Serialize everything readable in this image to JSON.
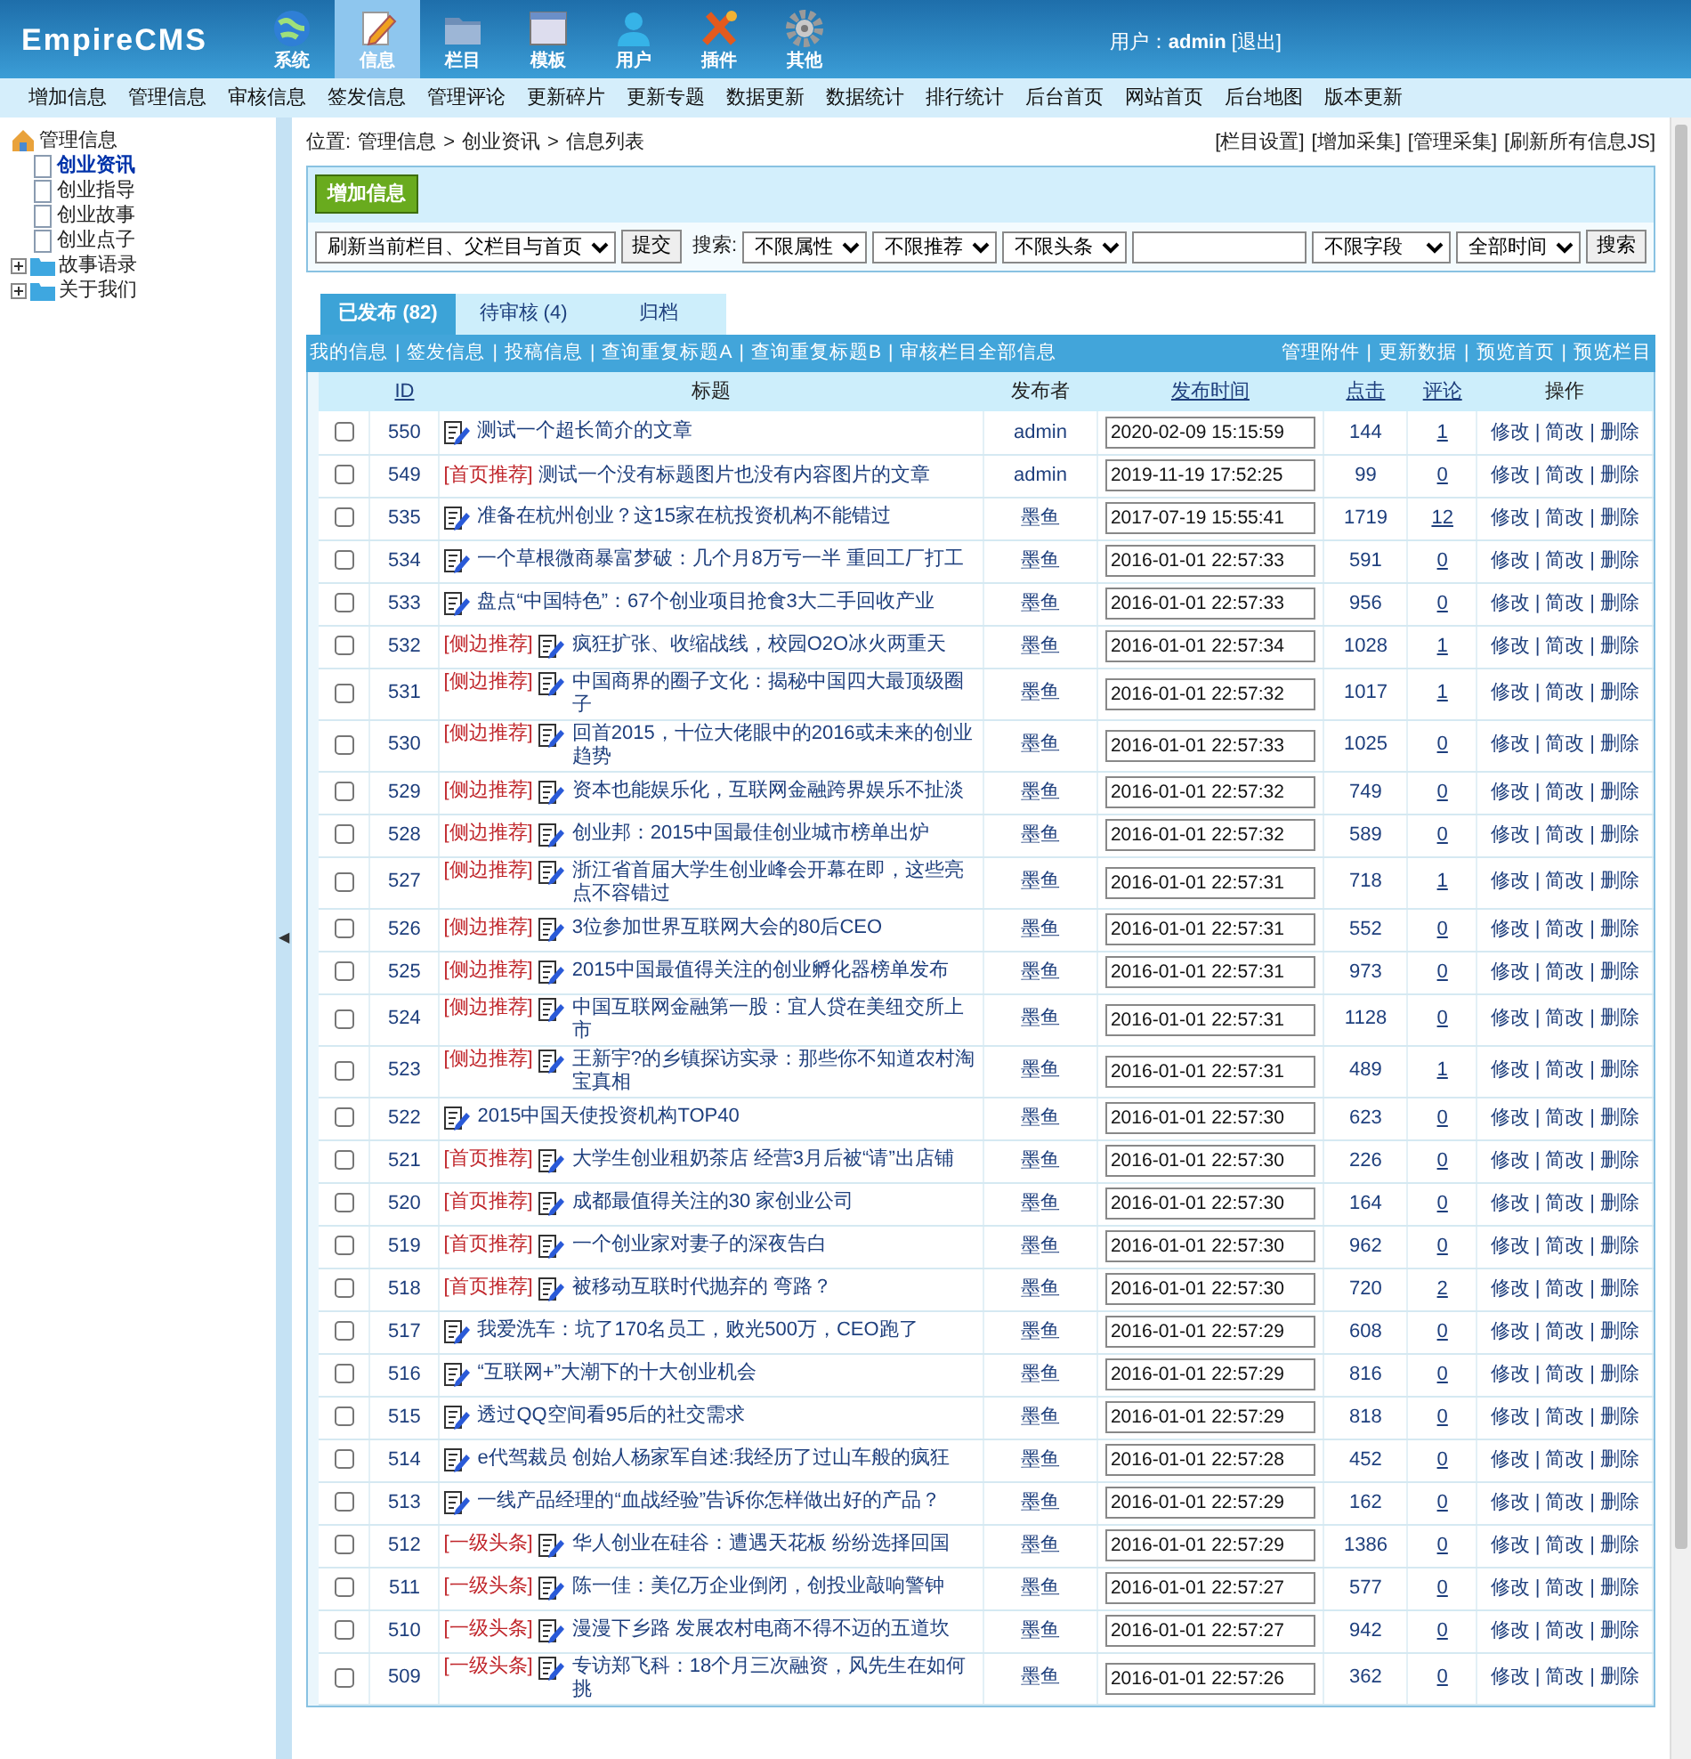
{
  "header": {
    "logo": "EmpireCMS",
    "nav": [
      {
        "label": "系统",
        "selected": false
      },
      {
        "label": "信息",
        "selected": true
      },
      {
        "label": "栏目",
        "selected": false
      },
      {
        "label": "模板",
        "selected": false
      },
      {
        "label": "用户",
        "selected": false
      },
      {
        "label": "插件",
        "selected": false
      },
      {
        "label": "其他",
        "selected": false
      }
    ],
    "user_label": "用户：",
    "user": "admin",
    "logout": "[退出]"
  },
  "menu": [
    "增加信息",
    "管理信息",
    "审核信息",
    "签发信息",
    "管理评论",
    "更新碎片",
    "更新专题",
    "数据更新",
    "数据统计",
    "排行统计",
    "后台首页",
    "网站首页",
    "后台地图",
    "版本更新"
  ],
  "sidebar": {
    "tree": [
      {
        "label": "管理信息",
        "expanded": true,
        "children": [
          {
            "label": "创业资讯",
            "selected": true
          },
          {
            "label": "创业指导",
            "selected": false
          },
          {
            "label": "创业故事",
            "selected": false
          },
          {
            "label": "创业点子",
            "selected": false
          }
        ]
      },
      {
        "label": "故事语录",
        "expanded": false
      },
      {
        "label": "关于我们",
        "expanded": false
      }
    ]
  },
  "breadcrumb": {
    "label": "位置:",
    "items": [
      "管理信息",
      "创业资讯",
      "信息列表"
    ],
    "sep": ">"
  },
  "top_links": [
    "[栏目设置]",
    "[增加采集]",
    "[管理采集]",
    "[刷新所有信息JS]"
  ],
  "toolbar": {
    "add_button": "增加信息",
    "refresh_select": "刷新当前栏目、父栏目与首页",
    "submit_button": "提交",
    "search_label": "搜索:",
    "filters": [
      "不限属性",
      "不限推荐",
      "不限头条"
    ],
    "field_select": "不限字段",
    "time_select": "全部时间",
    "search_button": "搜索"
  },
  "tabs": [
    {
      "label": "已发布 (82)",
      "selected": true
    },
    {
      "label": "待审核 (4)",
      "selected": false
    },
    {
      "label": "归档",
      "selected": false
    }
  ],
  "splitter": {
    "arrow": "◀"
  },
  "link_separator": "|",
  "action_separator": "|",
  "links_left": [
    "我的信息",
    "签发信息",
    "投稿信息",
    "查询重复标题A",
    "查询重复标题B",
    "审核栏目全部信息"
  ],
  "links_right": [
    "管理附件",
    "更新数据",
    "预览首页",
    "预览栏目"
  ],
  "table": {
    "columns": [
      "",
      "ID",
      "标题",
      "发布者",
      "发布时间",
      "点击",
      "评论",
      "操作"
    ],
    "rows": [
      {
        "checked": false,
        "id": "550",
        "tag": "",
        "icon": true,
        "title": "测试一个超长简介的文章",
        "author": "admin",
        "time": "2020-02-09 15:15:59",
        "clicks": "144",
        "comments": "1",
        "actions": [
          "修改",
          "简改",
          "删除"
        ]
      },
      {
        "checked": false,
        "id": "549",
        "tag": "[首页推荐]",
        "icon": false,
        "title": "测试一个没有标题图片也没有内容图片的文章",
        "author": "admin",
        "time": "2019-11-19 17:52:25",
        "clicks": "99",
        "comments": "0",
        "actions": [
          "修改",
          "简改",
          "删除"
        ]
      },
      {
        "checked": false,
        "id": "535",
        "tag": "",
        "icon": true,
        "title": "准备在杭州创业？这15家在杭投资机构不能错过",
        "author": "墨鱼",
        "time": "2017-07-19 15:55:41",
        "clicks": "1719",
        "comments": "12",
        "actions": [
          "修改",
          "简改",
          "删除"
        ]
      },
      {
        "checked": false,
        "id": "534",
        "tag": "",
        "icon": true,
        "title": "一个草根微商暴富梦破：几个月8万亏一半 重回工厂打工",
        "author": "墨鱼",
        "time": "2016-01-01 22:57:33",
        "clicks": "591",
        "comments": "0",
        "actions": [
          "修改",
          "简改",
          "删除"
        ]
      },
      {
        "checked": false,
        "id": "533",
        "tag": "",
        "icon": true,
        "title": "盘点“中国特色”：67个创业项目抢食3大二手回收产业",
        "author": "墨鱼",
        "time": "2016-01-01 22:57:33",
        "clicks": "956",
        "comments": "0",
        "actions": [
          "修改",
          "简改",
          "删除"
        ]
      },
      {
        "checked": false,
        "id": "532",
        "tag": "[侧边推荐]",
        "icon": true,
        "title": "疯狂扩张、收缩战线，校园O2O冰火两重天",
        "author": "墨鱼",
        "time": "2016-01-01 22:57:34",
        "clicks": "1028",
        "comments": "1",
        "actions": [
          "修改",
          "简改",
          "删除"
        ]
      },
      {
        "checked": false,
        "id": "531",
        "tag": "[侧边推荐]",
        "icon": true,
        "title": "中国商界的圈子文化：揭秘中国四大最顶级圈子",
        "author": "墨鱼",
        "time": "2016-01-01 22:57:32",
        "clicks": "1017",
        "comments": "1",
        "actions": [
          "修改",
          "简改",
          "删除"
        ]
      },
      {
        "checked": false,
        "id": "530",
        "tag": "[侧边推荐]",
        "icon": true,
        "title": "回首2015，十位大佬眼中的2016或未来的创业趋势",
        "author": "墨鱼",
        "time": "2016-01-01 22:57:33",
        "clicks": "1025",
        "comments": "0",
        "actions": [
          "修改",
          "简改",
          "删除"
        ]
      },
      {
        "checked": false,
        "id": "529",
        "tag": "[侧边推荐]",
        "icon": true,
        "title": "资本也能娱乐化，互联网金融跨界娱乐不扯淡",
        "author": "墨鱼",
        "time": "2016-01-01 22:57:32",
        "clicks": "749",
        "comments": "0",
        "actions": [
          "修改",
          "简改",
          "删除"
        ]
      },
      {
        "checked": false,
        "id": "528",
        "tag": "[侧边推荐]",
        "icon": true,
        "title": "创业邦：2015中国最佳创业城市榜单出炉",
        "author": "墨鱼",
        "time": "2016-01-01 22:57:32",
        "clicks": "589",
        "comments": "0",
        "actions": [
          "修改",
          "简改",
          "删除"
        ]
      },
      {
        "checked": false,
        "id": "527",
        "tag": "[侧边推荐]",
        "icon": true,
        "title": "浙江省首届大学生创业峰会开幕在即，这些亮点不容错过",
        "author": "墨鱼",
        "time": "2016-01-01 22:57:31",
        "clicks": "718",
        "comments": "1",
        "actions": [
          "修改",
          "简改",
          "删除"
        ]
      },
      {
        "checked": false,
        "id": "526",
        "tag": "[侧边推荐]",
        "icon": true,
        "title": "3位参加世界互联网大会的80后CEO",
        "author": "墨鱼",
        "time": "2016-01-01 22:57:31",
        "clicks": "552",
        "comments": "0",
        "actions": [
          "修改",
          "简改",
          "删除"
        ]
      },
      {
        "checked": false,
        "id": "525",
        "tag": "[侧边推荐]",
        "icon": true,
        "title": "2015中国最值得关注的创业孵化器榜单发布",
        "author": "墨鱼",
        "time": "2016-01-01 22:57:31",
        "clicks": "973",
        "comments": "0",
        "actions": [
          "修改",
          "简改",
          "删除"
        ]
      },
      {
        "checked": false,
        "id": "524",
        "tag": "[侧边推荐]",
        "icon": true,
        "title": "中国互联网金融第一股：宜人贷在美纽交所上市",
        "author": "墨鱼",
        "time": "2016-01-01 22:57:31",
        "clicks": "1128",
        "comments": "0",
        "actions": [
          "修改",
          "简改",
          "删除"
        ]
      },
      {
        "checked": false,
        "id": "523",
        "tag": "[侧边推荐]",
        "icon": true,
        "title": "王新宇?的乡镇探访实录：那些你不知道农村淘宝真相",
        "author": "墨鱼",
        "time": "2016-01-01 22:57:31",
        "clicks": "489",
        "comments": "1",
        "actions": [
          "修改",
          "简改",
          "删除"
        ]
      },
      {
        "checked": false,
        "id": "522",
        "tag": "",
        "icon": true,
        "title": "2015中国天使投资机构TOP40",
        "author": "墨鱼",
        "time": "2016-01-01 22:57:30",
        "clicks": "623",
        "comments": "0",
        "actions": [
          "修改",
          "简改",
          "删除"
        ]
      },
      {
        "checked": false,
        "id": "521",
        "tag": "[首页推荐]",
        "icon": true,
        "title": "大学生创业租奶茶店 经营3月后被“请”出店铺",
        "author": "墨鱼",
        "time": "2016-01-01 22:57:30",
        "clicks": "226",
        "comments": "0",
        "actions": [
          "修改",
          "简改",
          "删除"
        ]
      },
      {
        "checked": false,
        "id": "520",
        "tag": "[首页推荐]",
        "icon": true,
        "title": "成都最值得关注的30 家创业公司",
        "author": "墨鱼",
        "time": "2016-01-01 22:57:30",
        "clicks": "164",
        "comments": "0",
        "actions": [
          "修改",
          "简改",
          "删除"
        ]
      },
      {
        "checked": false,
        "id": "519",
        "tag": "[首页推荐]",
        "icon": true,
        "title": "一个创业家对妻子的深夜告白",
        "author": "墨鱼",
        "time": "2016-01-01 22:57:30",
        "clicks": "962",
        "comments": "0",
        "actions": [
          "修改",
          "简改",
          "删除"
        ]
      },
      {
        "checked": false,
        "id": "518",
        "tag": "[首页推荐]",
        "icon": true,
        "title": "被移动互联时代抛弃的 弯路？",
        "author": "墨鱼",
        "time": "2016-01-01 22:57:30",
        "clicks": "720",
        "comments": "2",
        "actions": [
          "修改",
          "简改",
          "删除"
        ]
      },
      {
        "checked": false,
        "id": "517",
        "tag": "",
        "icon": true,
        "title": "我爱洗车：坑了170名员工，败光500万，CEO跑了",
        "author": "墨鱼",
        "time": "2016-01-01 22:57:29",
        "clicks": "608",
        "comments": "0",
        "actions": [
          "修改",
          "简改",
          "删除"
        ]
      },
      {
        "checked": false,
        "id": "516",
        "tag": "",
        "icon": true,
        "title": "“互联网+”大潮下的十大创业机会",
        "author": "墨鱼",
        "time": "2016-01-01 22:57:29",
        "clicks": "816",
        "comments": "0",
        "actions": [
          "修改",
          "简改",
          "删除"
        ]
      },
      {
        "checked": false,
        "id": "515",
        "tag": "",
        "icon": true,
        "title": "透过QQ空间看95后的社交需求",
        "author": "墨鱼",
        "time": "2016-01-01 22:57:29",
        "clicks": "818",
        "comments": "0",
        "actions": [
          "修改",
          "简改",
          "删除"
        ]
      },
      {
        "checked": false,
        "id": "514",
        "tag": "",
        "icon": true,
        "title": "e代驾裁员 创始人杨家军自述:我经历了过山车般的疯狂",
        "author": "墨鱼",
        "time": "2016-01-01 22:57:28",
        "clicks": "452",
        "comments": "0",
        "actions": [
          "修改",
          "简改",
          "删除"
        ]
      },
      {
        "checked": false,
        "id": "513",
        "tag": "",
        "icon": true,
        "title": "一线产品经理的“血战经验”告诉你怎样做出好的产品？",
        "author": "墨鱼",
        "time": "2016-01-01 22:57:29",
        "clicks": "162",
        "comments": "0",
        "actions": [
          "修改",
          "简改",
          "删除"
        ]
      },
      {
        "checked": false,
        "id": "512",
        "tag": "[一级头条]",
        "icon": true,
        "title": "华人创业在硅谷：遭遇天花板 纷纷选择回国",
        "author": "墨鱼",
        "time": "2016-01-01 22:57:29",
        "clicks": "1386",
        "comments": "0",
        "actions": [
          "修改",
          "简改",
          "删除"
        ]
      },
      {
        "checked": false,
        "id": "511",
        "tag": "[一级头条]",
        "icon": true,
        "title": "陈一佳：美亿万企业倒闭，创投业敲响警钟",
        "author": "墨鱼",
        "time": "2016-01-01 22:57:27",
        "clicks": "577",
        "comments": "0",
        "actions": [
          "修改",
          "简改",
          "删除"
        ]
      },
      {
        "checked": false,
        "id": "510",
        "tag": "[一级头条]",
        "icon": true,
        "title": "漫漫下乡路 发展农村电商不得不迈的五道坎",
        "author": "墨鱼",
        "time": "2016-01-01 22:57:27",
        "clicks": "942",
        "comments": "0",
        "actions": [
          "修改",
          "简改",
          "删除"
        ]
      },
      {
        "checked": false,
        "id": "509",
        "tag": "[一级头条]",
        "icon": true,
        "title": "专访郑飞科：18个月三次融资，风先生在如何挑",
        "author": "墨鱼",
        "time": "2016-01-01 22:57:26",
        "clicks": "362",
        "comments": "0",
        "actions": [
          "修改",
          "简改",
          "删除"
        ]
      }
    ]
  }
}
